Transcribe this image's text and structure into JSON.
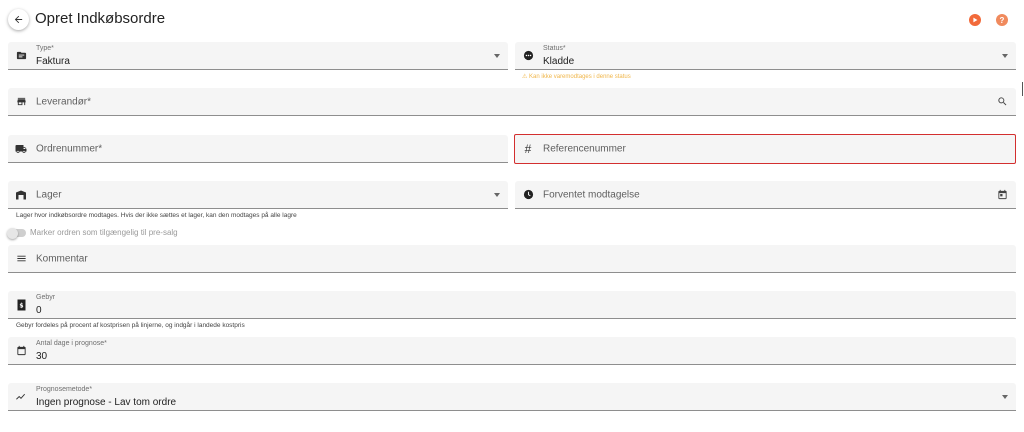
{
  "header": {
    "title": "Opret Indkøbsordre",
    "back_icon": "arrow-left-icon",
    "actions": [
      "play-icon",
      "help-icon"
    ],
    "help_glyph": "?"
  },
  "form": {
    "type": {
      "label": "Type*",
      "value": "Faktura",
      "icon": "receipt-icon"
    },
    "status": {
      "label": "Status*",
      "value": "Kladde",
      "icon": "dots-circle-icon",
      "warning": "⚠ Kan ikke varemodtages i denne status"
    },
    "supplier": {
      "placeholder": "Leverandør*",
      "icon": "store-icon"
    },
    "order_number": {
      "placeholder": "Ordrenummer*",
      "icon": "truck-icon"
    },
    "reference_number": {
      "placeholder": "Referencenummer",
      "icon": "hash-icon",
      "glyph": "#"
    },
    "warehouse": {
      "placeholder": "Lager",
      "icon": "warehouse-icon",
      "helper": "Lager hvor indkøbsordre modtages. Hvis der ikke sættes et lager, kan den modtages på alle lagre"
    },
    "expected_receipt": {
      "placeholder": "Forventet modtagelse",
      "icon": "clock-icon"
    },
    "presale_toggle": {
      "label": "Marker ordren som tilgængelig til pre-salg",
      "checked": false
    },
    "comment": {
      "placeholder": "Kommentar",
      "icon": "list-icon"
    },
    "fee": {
      "label": "Gebyr",
      "value": "0",
      "icon": "dollar-doc-icon",
      "helper": "Gebyr fordeles på procent af kostprisen på linjerne, og indgår i landede kostpris"
    },
    "forecast_days": {
      "label": "Antal dage i prognose*",
      "value": "30",
      "icon": "calendar-icon"
    },
    "forecast_method": {
      "label": "Prognosemetode*",
      "value": "Ingen prognose - Lav tom ordre",
      "icon": "trend-icon"
    }
  },
  "colors": {
    "accent_orange": "#f26a3a",
    "error_red": "#d32f2f",
    "warning_yellow": "#f0b64a",
    "field_bg": "#f5f5f5"
  }
}
